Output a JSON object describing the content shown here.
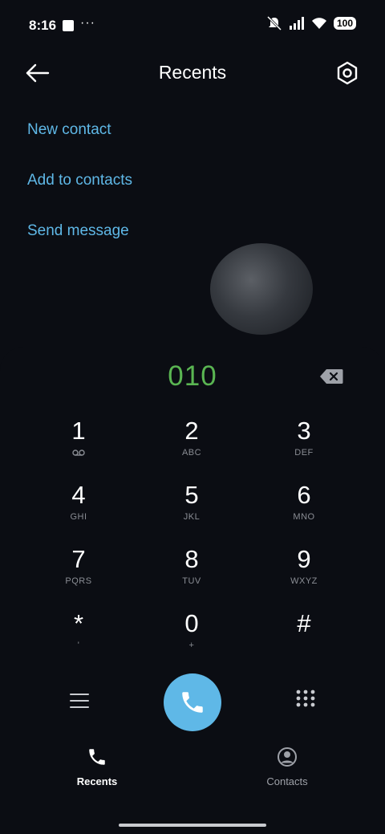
{
  "status_bar": {
    "time": "8:16",
    "dots": "···",
    "battery": "100"
  },
  "header": {
    "title": "Recents"
  },
  "actions": [
    "New contact",
    "Add to contacts",
    "Send message"
  ],
  "dialer": {
    "number": "010"
  },
  "keys": [
    {
      "digit": "1",
      "letters": ""
    },
    {
      "digit": "2",
      "letters": "ABC"
    },
    {
      "digit": "3",
      "letters": "DEF"
    },
    {
      "digit": "4",
      "letters": "GHI"
    },
    {
      "digit": "5",
      "letters": "JKL"
    },
    {
      "digit": "6",
      "letters": "MNO"
    },
    {
      "digit": "7",
      "letters": "PQRS"
    },
    {
      "digit": "8",
      "letters": "TUV"
    },
    {
      "digit": "9",
      "letters": "WXYZ"
    },
    {
      "digit": "*",
      "letters": "'"
    },
    {
      "digit": "0",
      "letters": "+"
    },
    {
      "digit": "#",
      "letters": ""
    }
  ],
  "nav": {
    "recents": "Recents",
    "contacts": "Contacts"
  },
  "colors": {
    "accent": "#5fb8e7",
    "number": "#5ab552",
    "background": "#0b0d13"
  },
  "icons": {
    "back": "arrow-left-icon",
    "settings": "hexagon-gear-icon",
    "backspace": "backspace-icon",
    "voicemail": "voicemail-icon",
    "menu": "hamburger-icon",
    "call": "phone-icon",
    "keypad": "dialpad-icon",
    "recents": "phone-icon",
    "contacts": "person-circle-icon"
  }
}
